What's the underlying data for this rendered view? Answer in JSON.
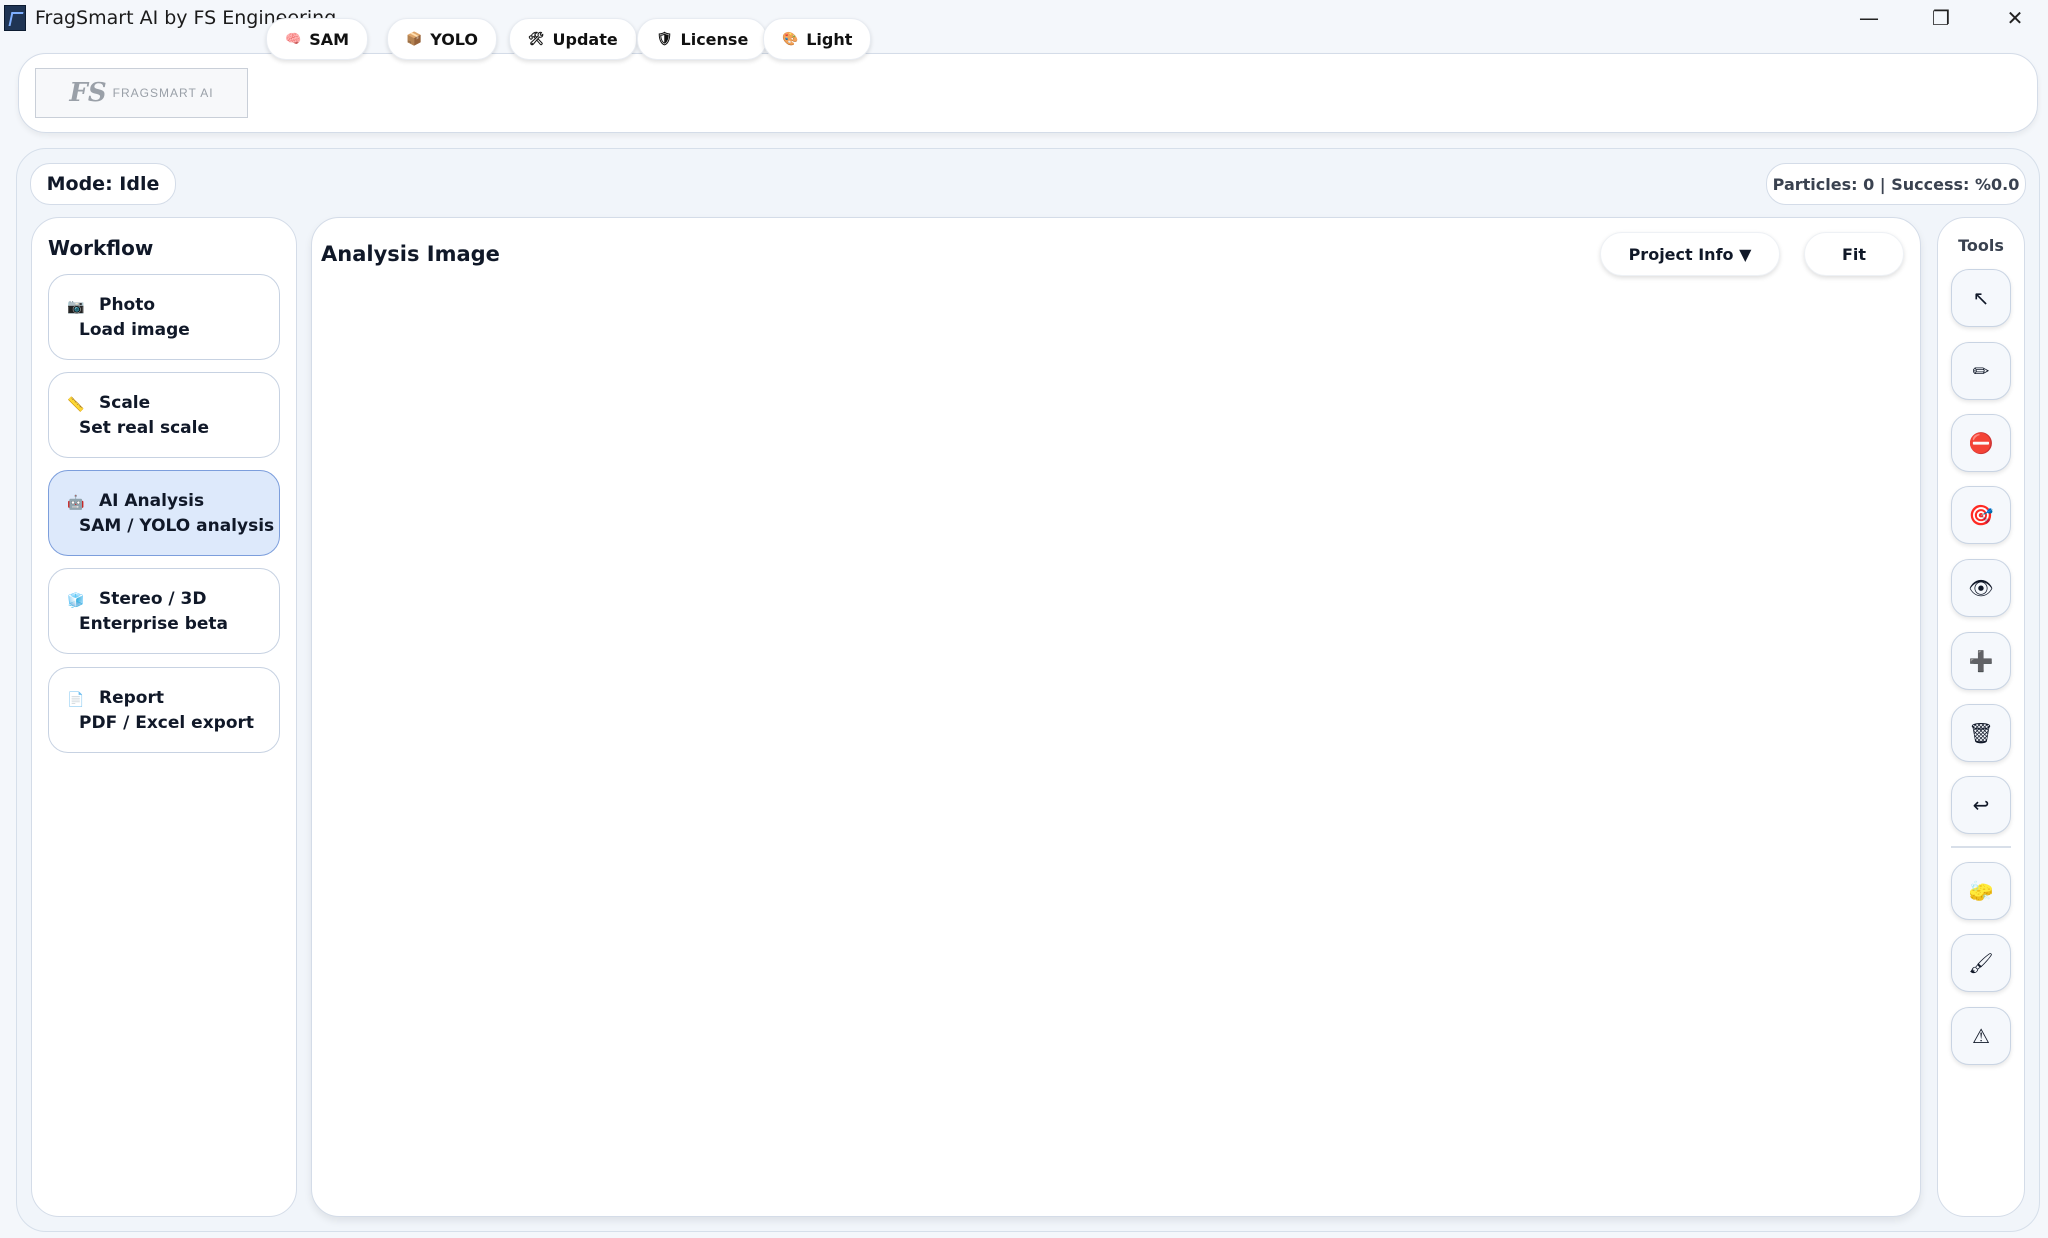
{
  "window": {
    "title": "FragSmart AI by FS Engineering",
    "minimize_glyph": "—",
    "maximize_glyph": "❐",
    "close_glyph": "✕"
  },
  "logo": {
    "mark": "FS",
    "text": "FRAGSMART AI"
  },
  "nav": [
    {
      "icon": "🧠",
      "icon_name": "brain-icon",
      "label": "SAM"
    },
    {
      "icon": "📦",
      "icon_name": "package-icon",
      "label": "YOLO"
    },
    {
      "icon": "🛠",
      "icon_name": "tools-icon",
      "label": "Update"
    },
    {
      "icon": "🛡",
      "icon_name": "shield-icon",
      "label": "License"
    },
    {
      "icon": "🎨",
      "icon_name": "palette-icon",
      "label": "Light"
    }
  ],
  "status": {
    "mode": "Mode: Idle",
    "stats": "Particles: 0 | Success: %0.0"
  },
  "workflow": {
    "title": "Workflow",
    "steps": [
      {
        "icon": "📷",
        "icon_name": "camera-icon",
        "title": "Photo",
        "subtitle": "Load image",
        "active": false
      },
      {
        "icon": "📏",
        "icon_name": "ruler-icon",
        "title": "Scale",
        "subtitle": "Set real scale",
        "active": false
      },
      {
        "icon": "🤖",
        "icon_name": "robot-icon",
        "title": "AI Analysis",
        "subtitle": "SAM / YOLO analysis",
        "active": true
      },
      {
        "icon": "🧊",
        "icon_name": "cube-icon",
        "title": "Stereo / 3D",
        "subtitle": "Enterprise beta",
        "active": false
      },
      {
        "icon": "📄",
        "icon_name": "document-icon",
        "title": "Report",
        "subtitle": "PDF / Excel export",
        "active": false
      }
    ]
  },
  "canvas": {
    "title": "Analysis Image",
    "project_info_label": "Project Info ▼",
    "fit_label": "Fit"
  },
  "tools": {
    "title": "Tools",
    "buttons": [
      {
        "icon": "↖",
        "icon_name": "pointer-icon"
      },
      {
        "icon": "✏",
        "icon_name": "pencil-icon"
      },
      {
        "icon": "⛔",
        "icon_name": "no-entry-icon"
      },
      {
        "icon": "🎯",
        "icon_name": "target-icon"
      },
      {
        "icon": "👁",
        "icon_name": "eye-icon"
      },
      {
        "icon": "➕",
        "icon_name": "plus-icon"
      },
      {
        "icon": "🗑",
        "icon_name": "trash-icon"
      },
      {
        "icon": "↩",
        "icon_name": "undo-icon"
      },
      {
        "icon": "🧽",
        "icon_name": "sponge-icon"
      },
      {
        "icon": "🖌",
        "icon_name": "brush-icon"
      },
      {
        "icon": "⚠",
        "icon_name": "warning-icon"
      }
    ]
  }
}
